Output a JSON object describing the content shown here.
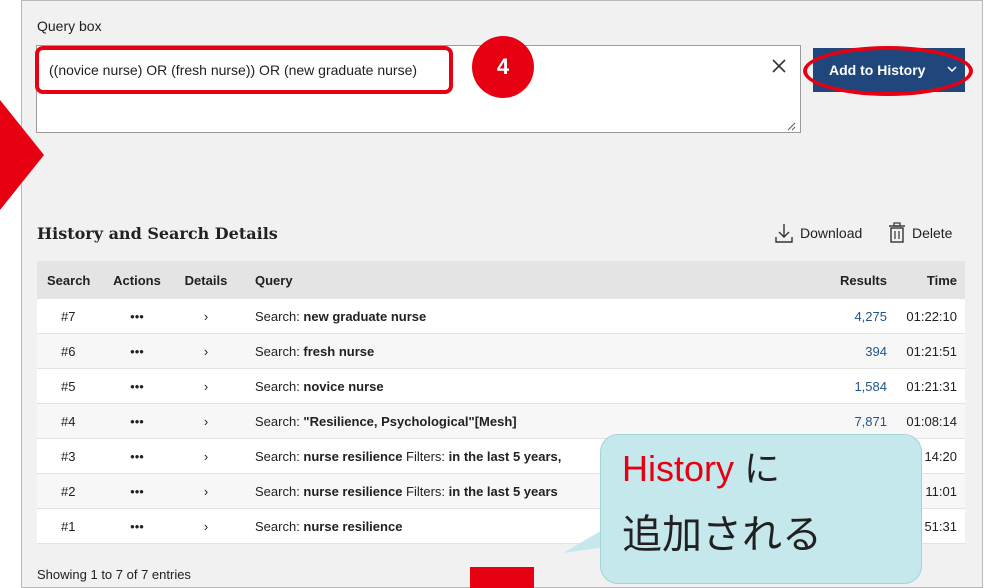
{
  "query_box": {
    "label": "Query box",
    "value": "((novice nurse) OR (fresh nurse)) OR (new graduate nurse)",
    "clear_icon": "close-icon",
    "add_button_label": "Add to History"
  },
  "annotation": {
    "step_number": "4",
    "callout_line1_highlight": "History",
    "callout_line1_rest": " に",
    "callout_line2": "追加される",
    "accent_color": "#e60012",
    "callout_color": "#c5e8ed"
  },
  "history": {
    "title": "History and Search Details",
    "download_label": "Download",
    "delete_label": "Delete",
    "columns": [
      "Search",
      "Actions",
      "Details",
      "Query",
      "Results",
      "Time"
    ],
    "rows": [
      {
        "search": "#7",
        "actions": "•••",
        "details": "›",
        "query_prefix": "Search: ",
        "query_term": "new graduate nurse",
        "filters_label": "",
        "filters": "",
        "results": "4,275",
        "time": "01:22:10"
      },
      {
        "search": "#6",
        "actions": "•••",
        "details": "›",
        "query_prefix": "Search: ",
        "query_term": "fresh nurse",
        "filters_label": "",
        "filters": "",
        "results": "394",
        "time": "01:21:51"
      },
      {
        "search": "#5",
        "actions": "•••",
        "details": "›",
        "query_prefix": "Search: ",
        "query_term": "novice nurse",
        "filters_label": "",
        "filters": "",
        "results": "1,584",
        "time": "01:21:31"
      },
      {
        "search": "#4",
        "actions": "•••",
        "details": "›",
        "query_prefix": "Search: ",
        "query_term": "\"Resilience, Psychological\"[Mesh]",
        "filters_label": "",
        "filters": "",
        "results": "7,871",
        "time": "01:08:14"
      },
      {
        "search": "#3",
        "actions": "•••",
        "details": "›",
        "query_prefix": "Search: ",
        "query_term": "nurse resilience",
        "filters_label": " Filters: ",
        "filters": "in the last 5 years,",
        "results": "",
        "time": "14:20"
      },
      {
        "search": "#2",
        "actions": "•••",
        "details": "›",
        "query_prefix": "Search: ",
        "query_term": "nurse resilience",
        "filters_label": " Filters: ",
        "filters": "in the last 5 years",
        "results": "",
        "time": "11:01"
      },
      {
        "search": "#1",
        "actions": "•••",
        "details": "›",
        "query_prefix": "Search: ",
        "query_term": "nurse resilience",
        "filters_label": "",
        "filters": "",
        "results": "",
        "time": "51:31"
      }
    ],
    "footer": "Showing 1 to 7 of 7 entries"
  }
}
